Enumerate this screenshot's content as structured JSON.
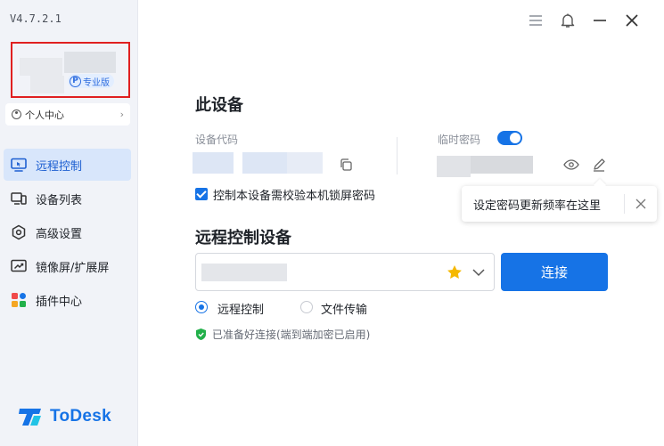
{
  "app": {
    "version": "V4.7.2.1",
    "brand": "ToDesk"
  },
  "profile": {
    "badge_letter": "P",
    "badge_label": "专业版",
    "user_center_label": "个人中心"
  },
  "nav": {
    "items": [
      {
        "label": "远程控制",
        "icon": "monitor-remote-icon",
        "active": true
      },
      {
        "label": "设备列表",
        "icon": "device-list-icon",
        "active": false
      },
      {
        "label": "高级设置",
        "icon": "settings-hex-icon",
        "active": false
      },
      {
        "label": "镜像屏/扩展屏",
        "icon": "mirror-screen-icon",
        "active": false
      },
      {
        "label": "插件中心",
        "icon": "plugin-grid-icon",
        "active": false
      }
    ]
  },
  "device": {
    "title": "此设备",
    "code_label": "设备代码",
    "temp_password_label": "临时密码",
    "temp_password_enabled": true,
    "lock_screen_check_label": "控制本设备需校验本机锁屏密码",
    "lock_screen_checked": true,
    "tooltip_text": "设定密码更新频率在这里"
  },
  "remote": {
    "title": "远程控制设备",
    "connect_label": "连接",
    "modes": [
      {
        "label": "远程控制",
        "selected": true
      },
      {
        "label": "文件传输",
        "selected": false
      }
    ],
    "status_text": "已准备好连接(端到端加密已启用)"
  },
  "colors": {
    "accent": "#1673e6",
    "highlight_border": "#e02020",
    "status_green": "#22b04a",
    "star": "#f5b800"
  }
}
